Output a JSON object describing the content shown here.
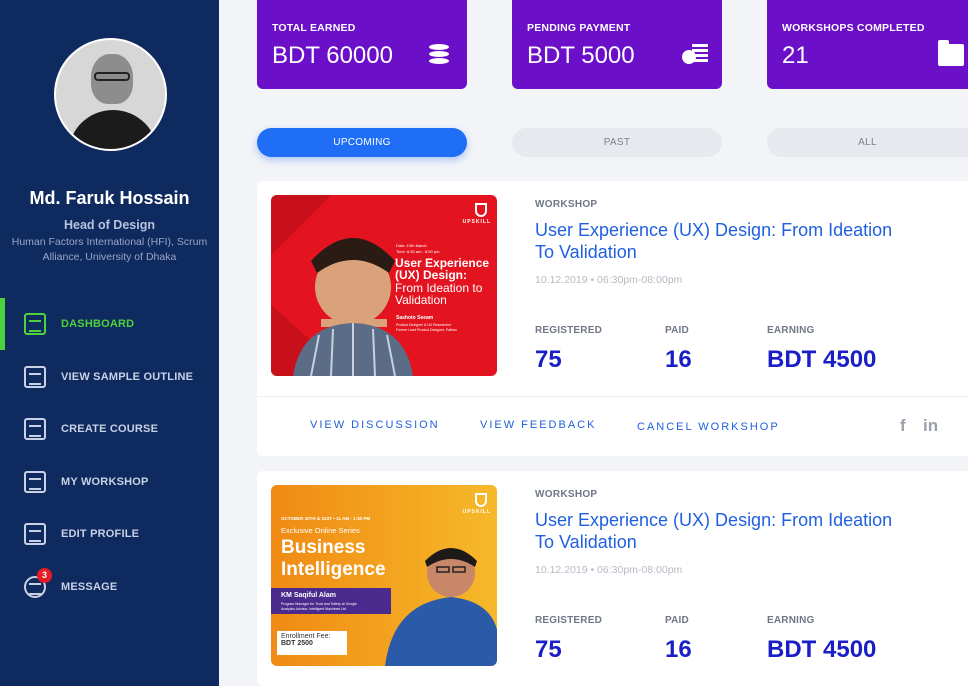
{
  "profile": {
    "name": "Md. Faruk Hossain",
    "role": "Head of Design",
    "org": "Human Factors International (HFI), Scrum Alliance, University of Dhaka"
  },
  "nav": [
    {
      "label": "DASHBOARD",
      "icon": "dashboard-icon",
      "active": true
    },
    {
      "label": "VIEW SAMPLE OUTLINE",
      "icon": "document-icon"
    },
    {
      "label": "CREATE COURSE",
      "icon": "edit-document-icon"
    },
    {
      "label": "MY WORKSHOP",
      "icon": "presentation-icon"
    },
    {
      "label": "EDIT PROFILE",
      "icon": "profile-card-icon"
    },
    {
      "label": "MESSAGE",
      "icon": "chat-icon",
      "badge": "3"
    }
  ],
  "stats": [
    {
      "label": "TOTAL EARNED",
      "value": "BDT 60000",
      "icon": "coins-icon"
    },
    {
      "label": "PENDING PAYMENT",
      "value": "BDT 5000",
      "icon": "cash-icon"
    },
    {
      "label": "WORKSHOPS COMPLETED",
      "value": "21",
      "icon": "folder-icon"
    }
  ],
  "tabs": [
    "UPCOMING",
    "PAST",
    "ALL"
  ],
  "colors": {
    "sidebar": "#0e2a5f",
    "accent_green": "#4cd23d",
    "stat_purple": "#6b0fc8",
    "primary_blue": "#1f6ef5"
  },
  "workshops": [
    {
      "kind": "WORKSHOP",
      "title": "User Experience (UX) Design: From Ideation To Validation",
      "date": "10.12.2019  •  06:30pm-08:00pm",
      "registered_label": "REGISTERED",
      "registered": "75",
      "paid_label": "PAID",
      "paid": "16",
      "earning_label": "EARNING",
      "earning": "BDT 4500",
      "poster": {
        "brand": "UPSKILL",
        "date_line": "Date: 10th March",
        "time_line": "Time: 6:30 am - 8:00 pm",
        "headline_1": "User Experience (UX) Design:",
        "headline_2": "From Ideation to Validation",
        "speaker": "Sashoto Seeam",
        "speaker_role_1": "Product Designer & UX Researcher",
        "speaker_role_2": "Former Lead Product Designer, Pathao"
      },
      "links": [
        "VIEW DISCUSSION",
        "VIEW FEEDBACK",
        "CANCEL WORKSHOP"
      ],
      "social": [
        "f",
        "in"
      ]
    },
    {
      "kind": "WORKSHOP",
      "title": "User Experience (UX) Design: From Ideation To Validation",
      "date": "10.12.2019  •  06:30pm-08:00pm",
      "registered_label": "REGISTERED",
      "registered": "75",
      "paid_label": "PAID",
      "paid": "16",
      "earning_label": "EARNING",
      "earning": "BDT 4500",
      "poster": {
        "brand": "UPSKILL",
        "date_line": "OCTOBER 30TH & 31ST • 11 AM - 1:30 PM",
        "series": "Exclusive Online Series",
        "headline_1": "Business",
        "headline_2": "Intelligence",
        "speaker": "KM Saqiful Alam",
        "speaker_role_1": "Program Manager for Trust and Safety at Google",
        "speaker_role_2": "Analytics Advisor, Intelligent Machines Ltd",
        "fee_label": "Enrollment Fee:",
        "fee": "BDT 2500"
      }
    }
  ]
}
